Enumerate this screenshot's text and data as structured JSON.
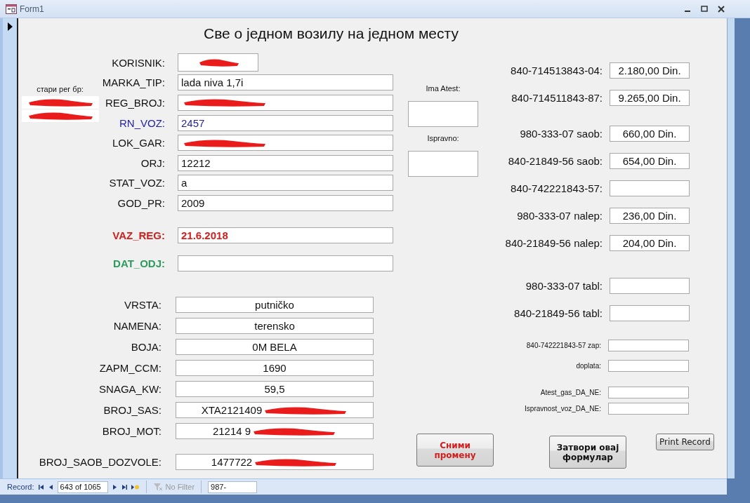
{
  "window": {
    "title": "Form1"
  },
  "form_title": "Све о једном возилу на једном месту",
  "old_reg": {
    "label": "стари рег бр:",
    "rows": [
      {
        "redacted": true
      },
      {
        "redacted": true
      }
    ]
  },
  "left_groups": [
    {
      "kind": "detail",
      "fields": [
        {
          "label": "KORISNIK:",
          "kind": "short",
          "redacted": true
        },
        {
          "label": "MARKA_TIP:",
          "value": "lada niva 1,7i"
        },
        {
          "label": "REG_BROJ:",
          "redacted": true
        },
        {
          "label": "RN_VOZ:",
          "value": "2457",
          "color": "#1f1fa8"
        },
        {
          "label": "LOK_GAR:",
          "redacted": true
        },
        {
          "label": "ORJ:",
          "value": "12212"
        },
        {
          "label": "STAT_VOZ:",
          "value": "a"
        },
        {
          "label": "GOD_PR:",
          "value": "2009"
        }
      ]
    },
    {
      "kind": "detail",
      "fields": [
        {
          "label": "VAZ_REG:",
          "value": "21.6.2018",
          "color": "#d21d1d",
          "bold": true
        }
      ]
    },
    {
      "kind": "detail",
      "fields": [
        {
          "label": "DAT_ODJ:",
          "color": "#2e9a5e",
          "bold": true
        }
      ]
    },
    {
      "kind": "spec",
      "fields": [
        {
          "label": "VRSTA:",
          "value": "putničko"
        },
        {
          "label": "NAMENA:",
          "value": "terensko"
        },
        {
          "label": "BOJA:",
          "value": "0M BELA"
        },
        {
          "label": "ZAPM_CCM:",
          "value": "1690"
        },
        {
          "label": "SNAGA_KW:",
          "value": "59,5"
        },
        {
          "label": "BROJ_SAS:",
          "value": "XTA2121409",
          "redacted": true
        },
        {
          "label": "BROJ_MOT:",
          "value": "21214 9",
          "redacted": true
        }
      ]
    },
    {
      "kind": "spec",
      "fields": [
        {
          "label": "BROJ_SAOB_DOZVOLE:",
          "value": "1477722",
          "redacted": true
        }
      ]
    }
  ],
  "checks": [
    {
      "label": "Ima Atest:"
    },
    {
      "label": "Ispravno:"
    }
  ],
  "right_groups": [
    {
      "kind": "large",
      "fields": [
        {
          "label": "840-714513843-04:",
          "value": "2.180,00 Din."
        },
        {
          "label": "840-714511843-87:",
          "value": "9.265,00 Din."
        }
      ]
    },
    {
      "kind": "large",
      "fields": [
        {
          "label": "980-333-07 saob:",
          "value": "660,00 Din."
        },
        {
          "label": "840-21849-56 saob:",
          "value": "654,00 Din."
        },
        {
          "label": "840-742221843-57:"
        },
        {
          "label": "980-333-07 nalep:",
          "value": "236,00 Din."
        },
        {
          "label": "840-21849-56 nalep:",
          "value": "204,00 Din."
        }
      ]
    },
    {
      "kind": "large",
      "fields": [
        {
          "label": "980-333-07 tabl:"
        },
        {
          "label": "840-21849-56 tabl:"
        }
      ]
    },
    {
      "kind": "small",
      "fields": [
        {
          "label": "840-742221843-57 zap:"
        },
        {
          "label": "doplata:"
        }
      ]
    },
    {
      "kind": "tiny",
      "fields": [
        {
          "label": "Atest_gas_DA_NE:"
        },
        {
          "label": "Ispravnost_voz_DA_NE:"
        }
      ]
    }
  ],
  "buttons": [
    {
      "label": "Сними промену",
      "kind": "save"
    },
    {
      "label": "Затвори овај формулар",
      "kind": "close"
    },
    {
      "label": "Print Record",
      "kind": "print"
    }
  ],
  "navigation": {
    "label": "Record:",
    "position": "643 of 1065",
    "filter": "No Filter",
    "search": "987-"
  }
}
